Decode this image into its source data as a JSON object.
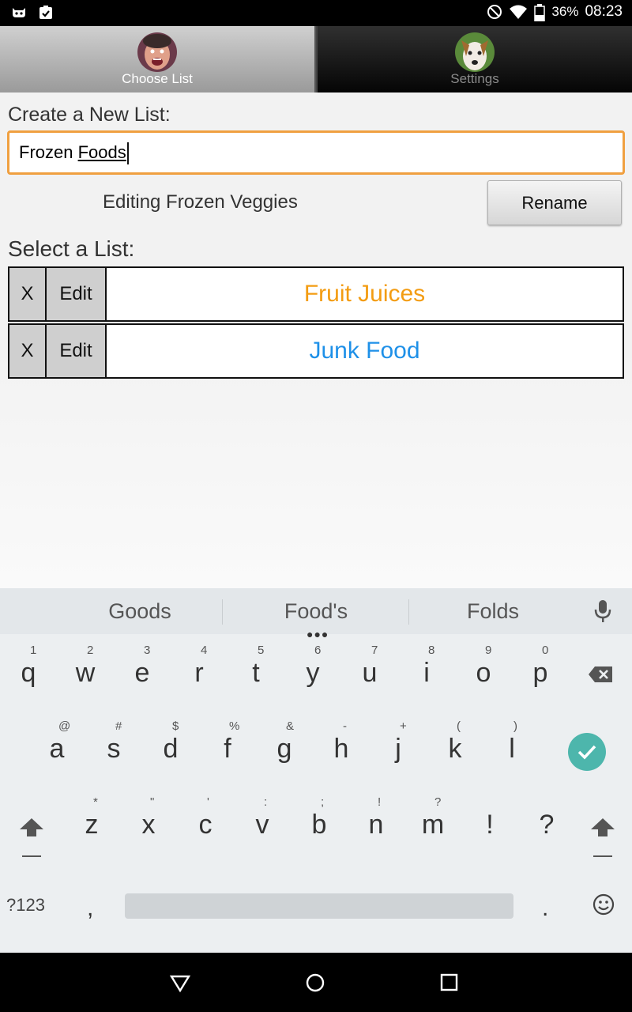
{
  "status_bar": {
    "battery": "36%",
    "time": "08:23"
  },
  "tabs": [
    {
      "label": "Choose List",
      "active": true
    },
    {
      "label": "Settings",
      "active": false
    }
  ],
  "form": {
    "create_label": "Create a New List:",
    "input_prefix": "Frozen ",
    "input_underlined": "Foods",
    "editing_text": "Editing Frozen Veggies",
    "rename_label": "Rename",
    "select_label": "Select a List:"
  },
  "lists": [
    {
      "delete": "X",
      "edit": "Edit",
      "name": "Fruit Juices",
      "color": "#f39c12"
    },
    {
      "delete": "X",
      "edit": "Edit",
      "name": "Junk Food",
      "color": "#1e90e8"
    }
  ],
  "keyboard": {
    "suggestions": [
      "Goods",
      "Food's",
      "Folds"
    ],
    "row1": [
      {
        "ch": "q",
        "hint": "1"
      },
      {
        "ch": "w",
        "hint": "2"
      },
      {
        "ch": "e",
        "hint": "3"
      },
      {
        "ch": "r",
        "hint": "4"
      },
      {
        "ch": "t",
        "hint": "5"
      },
      {
        "ch": "y",
        "hint": "6"
      },
      {
        "ch": "u",
        "hint": "7"
      },
      {
        "ch": "i",
        "hint": "8"
      },
      {
        "ch": "o",
        "hint": "9"
      },
      {
        "ch": "p",
        "hint": "0"
      }
    ],
    "row2": [
      {
        "ch": "a",
        "hint": "@"
      },
      {
        "ch": "s",
        "hint": "#"
      },
      {
        "ch": "d",
        "hint": "$"
      },
      {
        "ch": "f",
        "hint": "%"
      },
      {
        "ch": "g",
        "hint": "&"
      },
      {
        "ch": "h",
        "hint": "-"
      },
      {
        "ch": "j",
        "hint": "+"
      },
      {
        "ch": "k",
        "hint": "("
      },
      {
        "ch": "l",
        "hint": ")"
      }
    ],
    "row3": [
      {
        "ch": "z",
        "hint": "*"
      },
      {
        "ch": "x",
        "hint": "\""
      },
      {
        "ch": "c",
        "hint": "'"
      },
      {
        "ch": "v",
        "hint": ":"
      },
      {
        "ch": "b",
        "hint": ";"
      },
      {
        "ch": "n",
        "hint": "!"
      },
      {
        "ch": "m",
        "hint": "?"
      },
      {
        "ch": "!",
        "hint": ""
      },
      {
        "ch": "?",
        "hint": ""
      }
    ],
    "symbols_key": "?123",
    "comma_key": ",",
    "period_key": ".",
    "accent_color": "#4db6ac"
  }
}
